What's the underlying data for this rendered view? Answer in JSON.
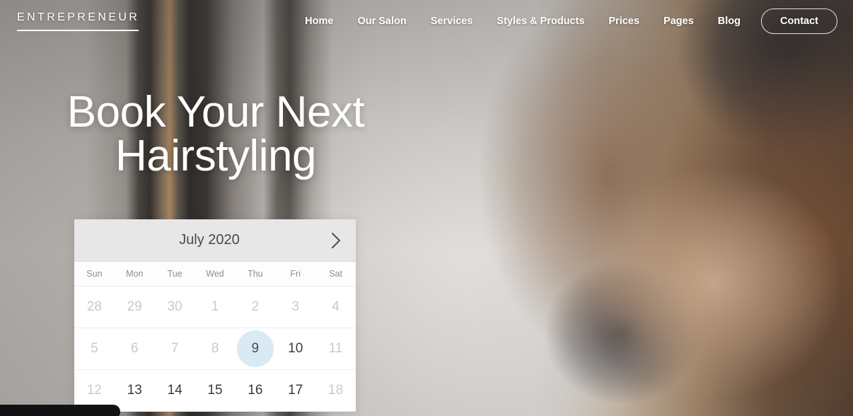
{
  "header": {
    "brand": "ENTREPRENEUR",
    "nav": [
      {
        "label": "Home"
      },
      {
        "label": "Our Salon"
      },
      {
        "label": "Services"
      },
      {
        "label": "Styles & Products"
      },
      {
        "label": "Prices"
      },
      {
        "label": "Pages"
      },
      {
        "label": "Blog"
      }
    ],
    "cta": "Contact"
  },
  "hero": {
    "title_line1": "Book Your Next",
    "title_line2": "Hairstyling"
  },
  "calendar": {
    "month_label": "July 2020",
    "next_icon": "chevron-right-icon",
    "weekdays": [
      "Sun",
      "Mon",
      "Tue",
      "Wed",
      "Thu",
      "Fri",
      "Sat"
    ],
    "selected_day": "9",
    "selected_color": "#d9eaf4",
    "weeks": [
      [
        {
          "day": "28",
          "state": "muted"
        },
        {
          "day": "29",
          "state": "muted"
        },
        {
          "day": "30",
          "state": "muted"
        },
        {
          "day": "1",
          "state": "muted"
        },
        {
          "day": "2",
          "state": "muted"
        },
        {
          "day": "3",
          "state": "muted"
        },
        {
          "day": "4",
          "state": "muted"
        }
      ],
      [
        {
          "day": "5",
          "state": "muted"
        },
        {
          "day": "6",
          "state": "muted"
        },
        {
          "day": "7",
          "state": "muted"
        },
        {
          "day": "8",
          "state": "muted"
        },
        {
          "day": "9",
          "state": "selected"
        },
        {
          "day": "10",
          "state": "enabled"
        },
        {
          "day": "11",
          "state": "muted"
        }
      ],
      [
        {
          "day": "12",
          "state": "muted"
        },
        {
          "day": "13",
          "state": "enabled"
        },
        {
          "day": "14",
          "state": "enabled"
        },
        {
          "day": "15",
          "state": "enabled"
        },
        {
          "day": "16",
          "state": "enabled"
        },
        {
          "day": "17",
          "state": "enabled"
        },
        {
          "day": "18",
          "state": "muted"
        }
      ]
    ]
  }
}
